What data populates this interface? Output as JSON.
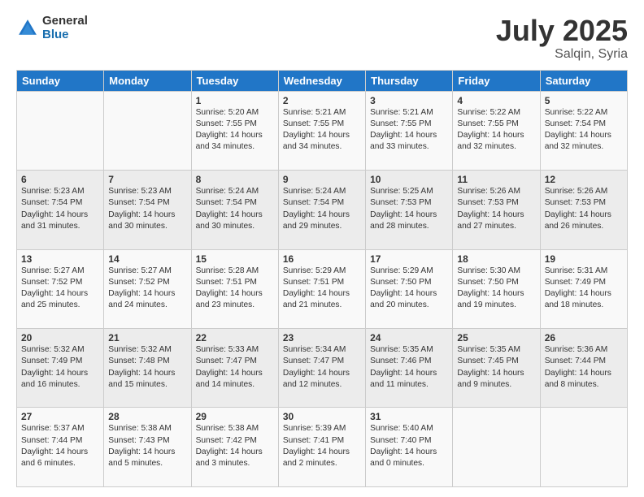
{
  "logo": {
    "general": "General",
    "blue": "Blue"
  },
  "title": "July 2025",
  "location": "Salqin, Syria",
  "header_days": [
    "Sunday",
    "Monday",
    "Tuesday",
    "Wednesday",
    "Thursday",
    "Friday",
    "Saturday"
  ],
  "weeks": [
    [
      {
        "day": "",
        "info": ""
      },
      {
        "day": "",
        "info": ""
      },
      {
        "day": "1",
        "info": "Sunrise: 5:20 AM\nSunset: 7:55 PM\nDaylight: 14 hours\nand 34 minutes."
      },
      {
        "day": "2",
        "info": "Sunrise: 5:21 AM\nSunset: 7:55 PM\nDaylight: 14 hours\nand 34 minutes."
      },
      {
        "day": "3",
        "info": "Sunrise: 5:21 AM\nSunset: 7:55 PM\nDaylight: 14 hours\nand 33 minutes."
      },
      {
        "day": "4",
        "info": "Sunrise: 5:22 AM\nSunset: 7:55 PM\nDaylight: 14 hours\nand 32 minutes."
      },
      {
        "day": "5",
        "info": "Sunrise: 5:22 AM\nSunset: 7:54 PM\nDaylight: 14 hours\nand 32 minutes."
      }
    ],
    [
      {
        "day": "6",
        "info": "Sunrise: 5:23 AM\nSunset: 7:54 PM\nDaylight: 14 hours\nand 31 minutes."
      },
      {
        "day": "7",
        "info": "Sunrise: 5:23 AM\nSunset: 7:54 PM\nDaylight: 14 hours\nand 30 minutes."
      },
      {
        "day": "8",
        "info": "Sunrise: 5:24 AM\nSunset: 7:54 PM\nDaylight: 14 hours\nand 30 minutes."
      },
      {
        "day": "9",
        "info": "Sunrise: 5:24 AM\nSunset: 7:54 PM\nDaylight: 14 hours\nand 29 minutes."
      },
      {
        "day": "10",
        "info": "Sunrise: 5:25 AM\nSunset: 7:53 PM\nDaylight: 14 hours\nand 28 minutes."
      },
      {
        "day": "11",
        "info": "Sunrise: 5:26 AM\nSunset: 7:53 PM\nDaylight: 14 hours\nand 27 minutes."
      },
      {
        "day": "12",
        "info": "Sunrise: 5:26 AM\nSunset: 7:53 PM\nDaylight: 14 hours\nand 26 minutes."
      }
    ],
    [
      {
        "day": "13",
        "info": "Sunrise: 5:27 AM\nSunset: 7:52 PM\nDaylight: 14 hours\nand 25 minutes."
      },
      {
        "day": "14",
        "info": "Sunrise: 5:27 AM\nSunset: 7:52 PM\nDaylight: 14 hours\nand 24 minutes."
      },
      {
        "day": "15",
        "info": "Sunrise: 5:28 AM\nSunset: 7:51 PM\nDaylight: 14 hours\nand 23 minutes."
      },
      {
        "day": "16",
        "info": "Sunrise: 5:29 AM\nSunset: 7:51 PM\nDaylight: 14 hours\nand 21 minutes."
      },
      {
        "day": "17",
        "info": "Sunrise: 5:29 AM\nSunset: 7:50 PM\nDaylight: 14 hours\nand 20 minutes."
      },
      {
        "day": "18",
        "info": "Sunrise: 5:30 AM\nSunset: 7:50 PM\nDaylight: 14 hours\nand 19 minutes."
      },
      {
        "day": "19",
        "info": "Sunrise: 5:31 AM\nSunset: 7:49 PM\nDaylight: 14 hours\nand 18 minutes."
      }
    ],
    [
      {
        "day": "20",
        "info": "Sunrise: 5:32 AM\nSunset: 7:49 PM\nDaylight: 14 hours\nand 16 minutes."
      },
      {
        "day": "21",
        "info": "Sunrise: 5:32 AM\nSunset: 7:48 PM\nDaylight: 14 hours\nand 15 minutes."
      },
      {
        "day": "22",
        "info": "Sunrise: 5:33 AM\nSunset: 7:47 PM\nDaylight: 14 hours\nand 14 minutes."
      },
      {
        "day": "23",
        "info": "Sunrise: 5:34 AM\nSunset: 7:47 PM\nDaylight: 14 hours\nand 12 minutes."
      },
      {
        "day": "24",
        "info": "Sunrise: 5:35 AM\nSunset: 7:46 PM\nDaylight: 14 hours\nand 11 minutes."
      },
      {
        "day": "25",
        "info": "Sunrise: 5:35 AM\nSunset: 7:45 PM\nDaylight: 14 hours\nand 9 minutes."
      },
      {
        "day": "26",
        "info": "Sunrise: 5:36 AM\nSunset: 7:44 PM\nDaylight: 14 hours\nand 8 minutes."
      }
    ],
    [
      {
        "day": "27",
        "info": "Sunrise: 5:37 AM\nSunset: 7:44 PM\nDaylight: 14 hours\nand 6 minutes."
      },
      {
        "day": "28",
        "info": "Sunrise: 5:38 AM\nSunset: 7:43 PM\nDaylight: 14 hours\nand 5 minutes."
      },
      {
        "day": "29",
        "info": "Sunrise: 5:38 AM\nSunset: 7:42 PM\nDaylight: 14 hours\nand 3 minutes."
      },
      {
        "day": "30",
        "info": "Sunrise: 5:39 AM\nSunset: 7:41 PM\nDaylight: 14 hours\nand 2 minutes."
      },
      {
        "day": "31",
        "info": "Sunrise: 5:40 AM\nSunset: 7:40 PM\nDaylight: 14 hours\nand 0 minutes."
      },
      {
        "day": "",
        "info": ""
      },
      {
        "day": "",
        "info": ""
      }
    ]
  ]
}
